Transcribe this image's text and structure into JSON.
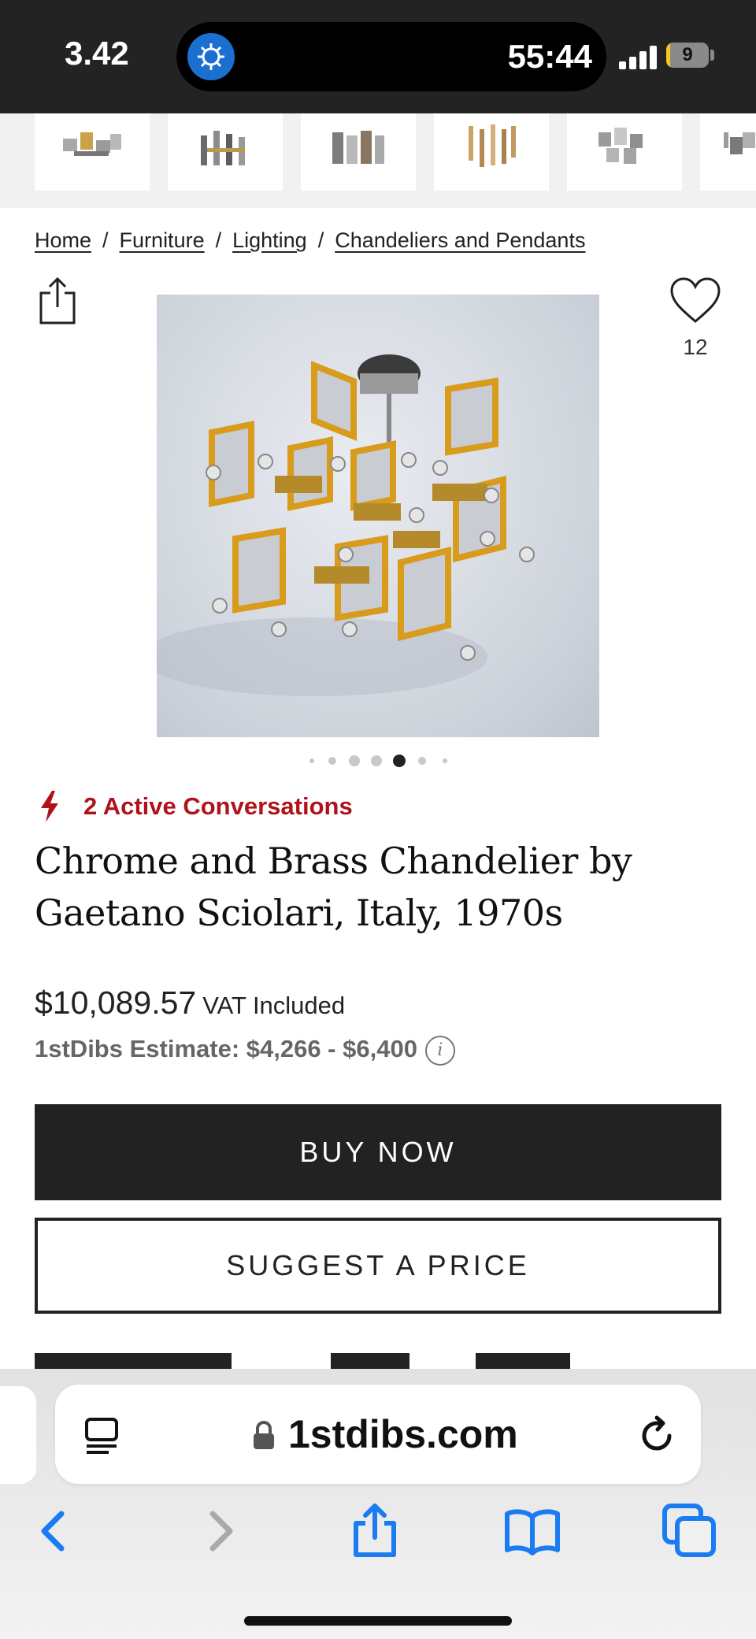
{
  "status_bar": {
    "time": "3.42",
    "island_timer": "55:44",
    "battery_level": "9"
  },
  "thumbnails": [
    "thumb-1",
    "thumb-2",
    "thumb-3",
    "thumb-4",
    "thumb-5",
    "thumb-6"
  ],
  "breadcrumb": {
    "items": [
      "Home",
      "Furniture",
      "Lighting",
      "Chandeliers and Pendants"
    ],
    "separator": "/"
  },
  "favorites": {
    "count": "12"
  },
  "gallery": {
    "total_images": 7,
    "active_index": 4
  },
  "conversations": {
    "label": "2 Active Conversations",
    "color": "#b0121b"
  },
  "product": {
    "title": "Chrome and Brass Chandelier by Gaetano Sciolari, Italy, 1970s",
    "price": "$10,089.57",
    "vat_note": "VAT Included",
    "estimate": "1stDibs Estimate: $4,266 - $6,400",
    "info_icon_glyph": "i"
  },
  "actions": {
    "buy_now": "BUY NOW",
    "suggest_price": "SUGGEST A PRICE"
  },
  "browser": {
    "url": "1stdibs.com",
    "accent_color": "#1a7bf2",
    "icons": [
      "reader-icon",
      "lock-icon",
      "reload-icon",
      "back-icon",
      "forward-icon",
      "share-icon",
      "bookmarks-icon",
      "tabs-icon"
    ]
  }
}
